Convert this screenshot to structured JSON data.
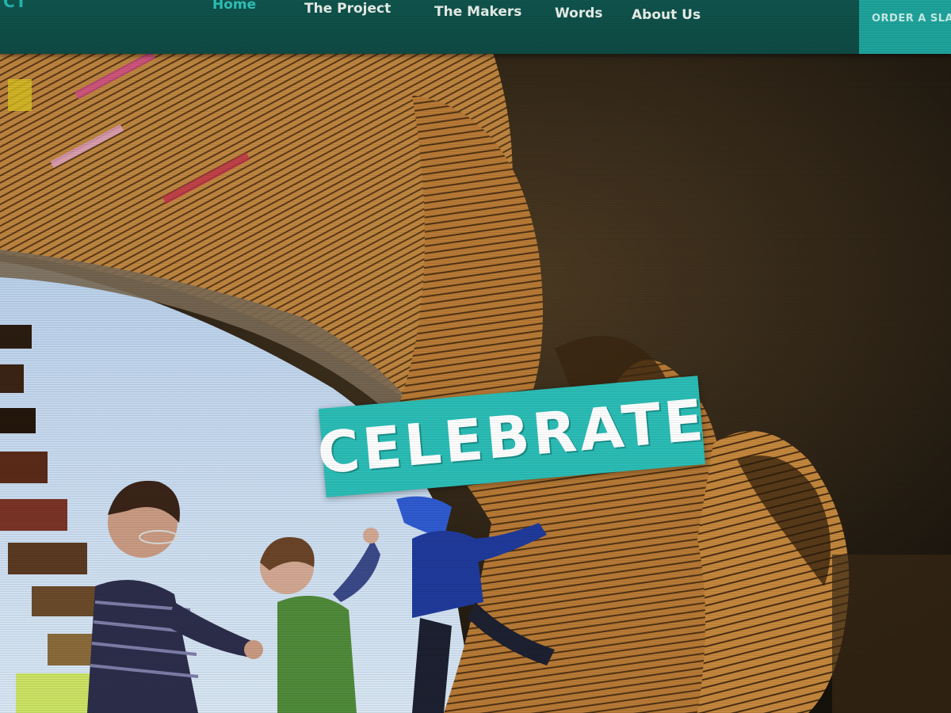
{
  "site": {
    "brand_fragment": "CT"
  },
  "nav": {
    "items": [
      {
        "label": "Home",
        "active": true
      },
      {
        "label": "The Project",
        "active": false
      },
      {
        "label": "The Makers",
        "active": false
      },
      {
        "label": "Words",
        "active": false
      },
      {
        "label": "About Us",
        "active": false
      }
    ],
    "cta_label": "ORDER A SLAT"
  },
  "hero": {
    "banner_text": "CELEBRATE",
    "image": "children-playing-in-wooden-slat-sculpture"
  },
  "colors": {
    "nav_bg": "#0f4e48",
    "accent": "#2bbdb6",
    "active_link": "#2ec1b8",
    "side_panel": "#5583c6"
  }
}
